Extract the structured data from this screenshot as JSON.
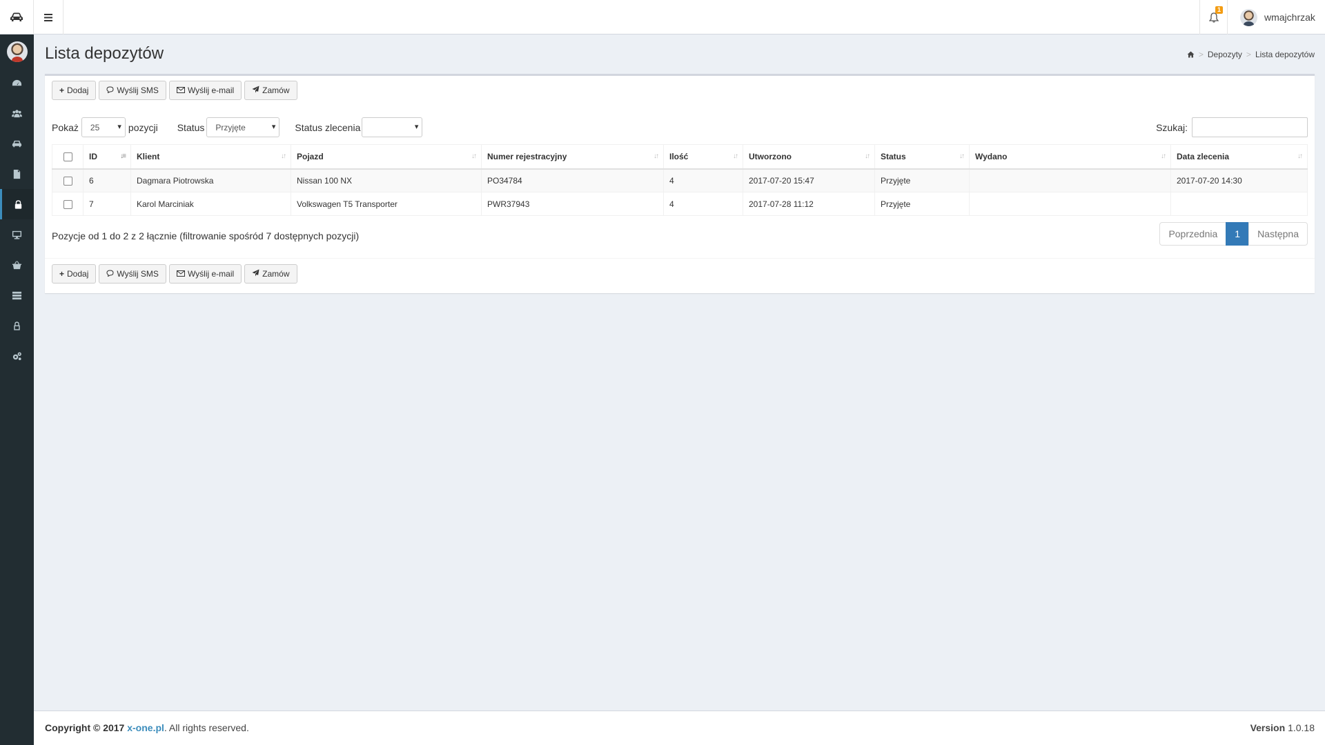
{
  "header": {
    "username": "wmajchrzak",
    "notification_count": "1"
  },
  "sidebar": {
    "items": [
      {
        "icon": "dashboard-icon"
      },
      {
        "icon": "users-icon"
      },
      {
        "icon": "car-icon"
      },
      {
        "icon": "document-icon"
      },
      {
        "icon": "lock-icon",
        "active": true
      },
      {
        "icon": "monitor-icon"
      },
      {
        "icon": "basket-icon"
      },
      {
        "icon": "list-icon"
      },
      {
        "icon": "user-lock-icon"
      },
      {
        "icon": "cogs-icon"
      }
    ]
  },
  "page": {
    "title": "Lista depozytów"
  },
  "breadcrumb": {
    "level1": "Depozyty",
    "level2": "Lista depozytów"
  },
  "toolbar": {
    "add": "Dodaj",
    "sms": "Wyślij SMS",
    "email": "Wyślij e-mail",
    "order": "Zamów"
  },
  "filters": {
    "show_label": "Pokaż",
    "show_value": "25",
    "positions_label": "pozycji",
    "status_label": "Status",
    "status_value": "Przyjęte",
    "order_status_label": "Status zlecenia",
    "order_status_value": "",
    "search_label": "Szukaj:"
  },
  "table": {
    "columns": [
      "ID",
      "Klient",
      "Pojazd",
      "Numer rejestracyjny",
      "Ilość",
      "Utworzono",
      "Status",
      "Wydano",
      "Data zlecenia"
    ],
    "rows": [
      [
        "6",
        "Dagmara Piotrowska",
        "Nissan 100 NX",
        "PO34784",
        "4",
        "2017-07-20 15:47",
        "Przyjęte",
        "",
        "2017-07-20 14:30"
      ],
      [
        "7",
        "Karol Marciniak",
        "Volkswagen T5 Transporter",
        "PWR37943",
        "4",
        "2017-07-28 11:12",
        "Przyjęte",
        "",
        ""
      ]
    ]
  },
  "info": "Pozycje od 1 do 2 z 2 łącznie (filtrowanie spośród 7 dostępnych pozycji)",
  "pagination": {
    "prev": "Poprzednia",
    "current": "1",
    "next": "Następna"
  },
  "footer": {
    "copyright_prefix": "Copyright © 2017",
    "link": "x-one.pl",
    "rights": ". All rights reserved.",
    "version_label": "Version",
    "version_value": "1.0.18"
  }
}
